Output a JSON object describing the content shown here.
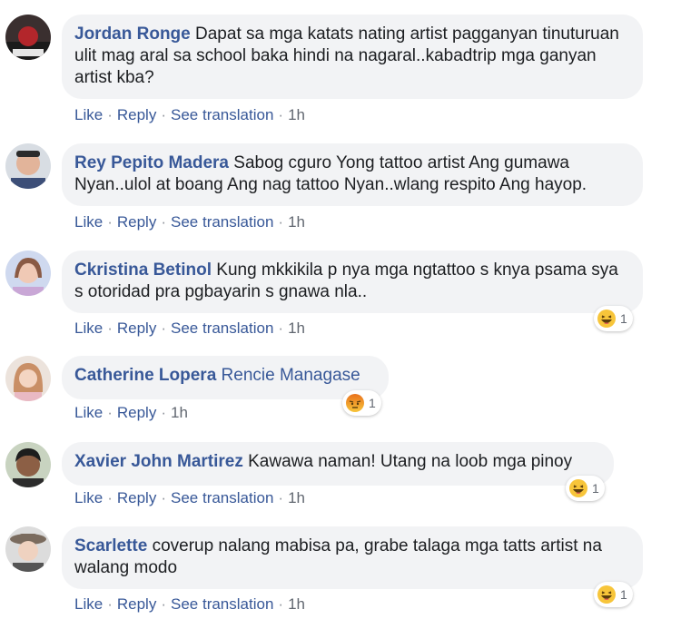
{
  "actions": {
    "like": "Like",
    "reply": "Reply",
    "see_translation": "See translation",
    "separator": "·"
  },
  "comments": [
    {
      "author": "Jordan Ronge",
      "text": "Dapat sa mga katats nating artist pagganyan tinuturuan ulit mag aral sa school baka hindi na nagaral..kabadtrip mga ganyan artist kba?",
      "time": "1h",
      "avatar_icon": "profile-photo-icon"
    },
    {
      "author": "Rey Pepito Madera",
      "text": "Sabog cguro Yong tattoo artist Ang gumawa Nyan..ulol at boang Ang nag tattoo Nyan..wlang respito Ang hayop.",
      "time": "1h",
      "avatar_icon": "profile-photo-icon"
    },
    {
      "author": "Ckristina Betinol",
      "text": "Kung mkkikila p nya mga ngtattoo s knya psama sya s otoridad pra pgbayarin s gnawa nla..",
      "time": "1h",
      "avatar_icon": "profile-photo-icon",
      "reaction": {
        "type": "haha-icon",
        "count": "1"
      }
    },
    {
      "author": "Catherine Lopera",
      "mention": "Rencie Managase",
      "time": "1h",
      "avatar_icon": "profile-photo-icon",
      "reaction": {
        "type": "angry-icon",
        "count": "1"
      }
    },
    {
      "author": "Xavier John Martirez",
      "text": "Kawawa naman! Utang na loob mga pinoy",
      "time": "1h",
      "avatar_icon": "profile-photo-icon",
      "reaction": {
        "type": "haha-icon",
        "count": "1"
      }
    },
    {
      "author": "Scarlette",
      "text": "coverup nalang mabisa pa, grabe talaga mga tatts artist na walang modo",
      "time": "1h",
      "avatar_icon": "profile-photo-icon",
      "reaction": {
        "type": "haha-icon",
        "count": "1"
      }
    }
  ],
  "colors": {
    "author_link": "#385898",
    "bubble_bg": "#f2f3f5",
    "action_text": "#4b4f56",
    "haha_yellow": "#f7c53a",
    "angry_orange": "#e9711c"
  }
}
